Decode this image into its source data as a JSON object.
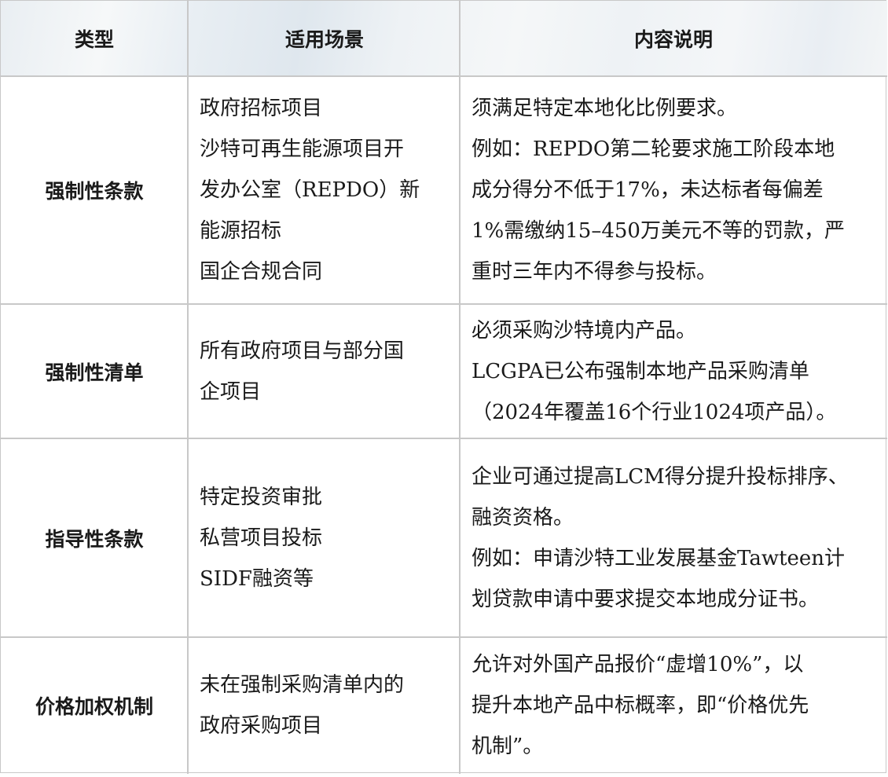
{
  "header": {
    "col1": "类型",
    "col2": "适用场景",
    "col3": "内容说明"
  },
  "rows": [
    {
      "type": "强制性条款",
      "scene_lines": [
        "政府招标项目",
        "沙特可再生能源项目开",
        "发办公室（REPDO）新",
        "能源招标",
        "国企合规合同"
      ],
      "content_lines": [
        "须满足特定本地化比例要求。",
        "例如：REPDO第二轮要求施工阶段本地",
        "成分得分不低于17%，未达标者每偏差",
        "1%需缴纳15–450万美元不等的罚款，严",
        "重时三年内不得参与投标。"
      ]
    },
    {
      "type": "强制性清单",
      "scene_lines": [
        "所有政府项目与部分国",
        "企项目"
      ],
      "content_lines": [
        "必须采购沙特境内产品。",
        "LCGPA已公布强制本地产品采购清单",
        "（2024年覆盖16个行业1024项产品）。"
      ]
    },
    {
      "type": "指导性条款",
      "scene_lines": [
        "特定投资审批",
        "私营项目投标",
        "SIDF融资等"
      ],
      "content_lines": [
        "企业可通过提高LCM得分提升投标排序、",
        "融资资格。",
        "例如：申请沙特工业发展基金Tawteen计",
        "划贷款申请中要求提交本地成分证书。"
      ]
    },
    {
      "type": "价格加权机制",
      "scene_lines": [
        "未在强制采购清单内的",
        "政府采购项目"
      ],
      "content_lines": [
        "允许对外国产品报价“虚增10%”，以",
        "提升本地产品中标概率，即“价格优先",
        "机制”。"
      ]
    }
  ]
}
